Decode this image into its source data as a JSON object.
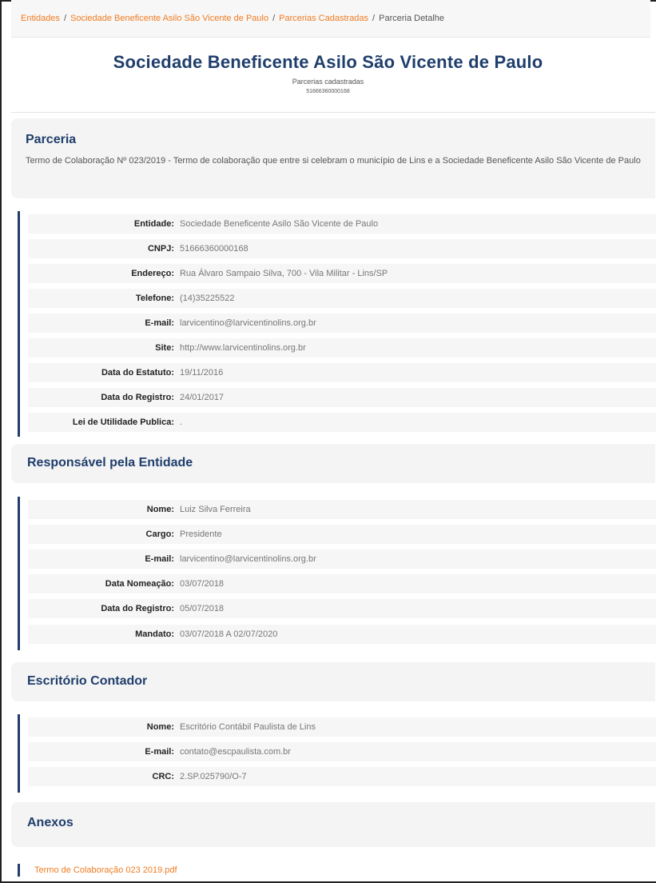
{
  "breadcrumb": [
    {
      "label": "Entidades",
      "link": true
    },
    {
      "label": "Sociedade Beneficente Asilo São Vicente de Paulo",
      "link": true
    },
    {
      "label": "Parcerias Cadastradas",
      "link": true
    },
    {
      "label": "Parceria Detalhe",
      "link": false
    }
  ],
  "header": {
    "title": "Sociedade Beneficente Asilo São Vicente de Paulo",
    "subtitle": "Parcerias cadastradas",
    "cnpj": "51666360000168"
  },
  "parceria": {
    "heading": "Parceria",
    "description": "Termo de Colaboração Nº 023/2019 - Termo de colaboração que entre si celebram o município de Lins e a Sociedade Beneficente Asilo São Vicente de Paulo"
  },
  "entidade": [
    {
      "label": "Entidade:",
      "value": "Sociedade Beneficente Asilo São Vicente de Paulo"
    },
    {
      "label": "CNPJ:",
      "value": "51666360000168"
    },
    {
      "label": "Endereço:",
      "value": "Rua Álvaro Sampaio Silva, 700 - Vila Militar - Lins/SP"
    },
    {
      "label": "Telefone:",
      "value": "(14)35225522"
    },
    {
      "label": "E-mail:",
      "value": "larvicentino@larvicentinolins.org.br"
    },
    {
      "label": "Site:",
      "value": "http://www.larvicentinolins.org.br"
    },
    {
      "label": "Data do Estatuto:",
      "value": "19/11/2016"
    },
    {
      "label": "Data do Registro:",
      "value": "24/01/2017"
    },
    {
      "label": "Lei de Utilidade Publica:",
      "value": "."
    }
  ],
  "responsavel": {
    "heading": "Responsável pela Entidade",
    "rows": [
      {
        "label": "Nome:",
        "value": "Luiz Silva Ferreira"
      },
      {
        "label": "Cargo:",
        "value": "Presidente"
      },
      {
        "label": "E-mail:",
        "value": "larvicentino@larvicentinolins.org.br"
      },
      {
        "label": "Data Nomeação:",
        "value": "03/07/2018"
      },
      {
        "label": "Data do Registro:",
        "value": "05/07/2018"
      },
      {
        "label": "Mandato:",
        "value": "03/07/2018 A 02/07/2020"
      }
    ]
  },
  "contador": {
    "heading": "Escritório Contador",
    "rows": [
      {
        "label": "Nome:",
        "value": "Escritório Contábil Paulista de Lins"
      },
      {
        "label": "E-mail:",
        "value": "contato@escpaulista.com.br"
      },
      {
        "label": "CRC:",
        "value": "2.SP.025790/O-7"
      }
    ]
  },
  "anexos": {
    "heading": "Anexos",
    "files": [
      "Termo de Colaboração 023 2019.pdf"
    ]
  },
  "colors": {
    "accent": "#f07c22",
    "heading": "#1f3e6c"
  }
}
